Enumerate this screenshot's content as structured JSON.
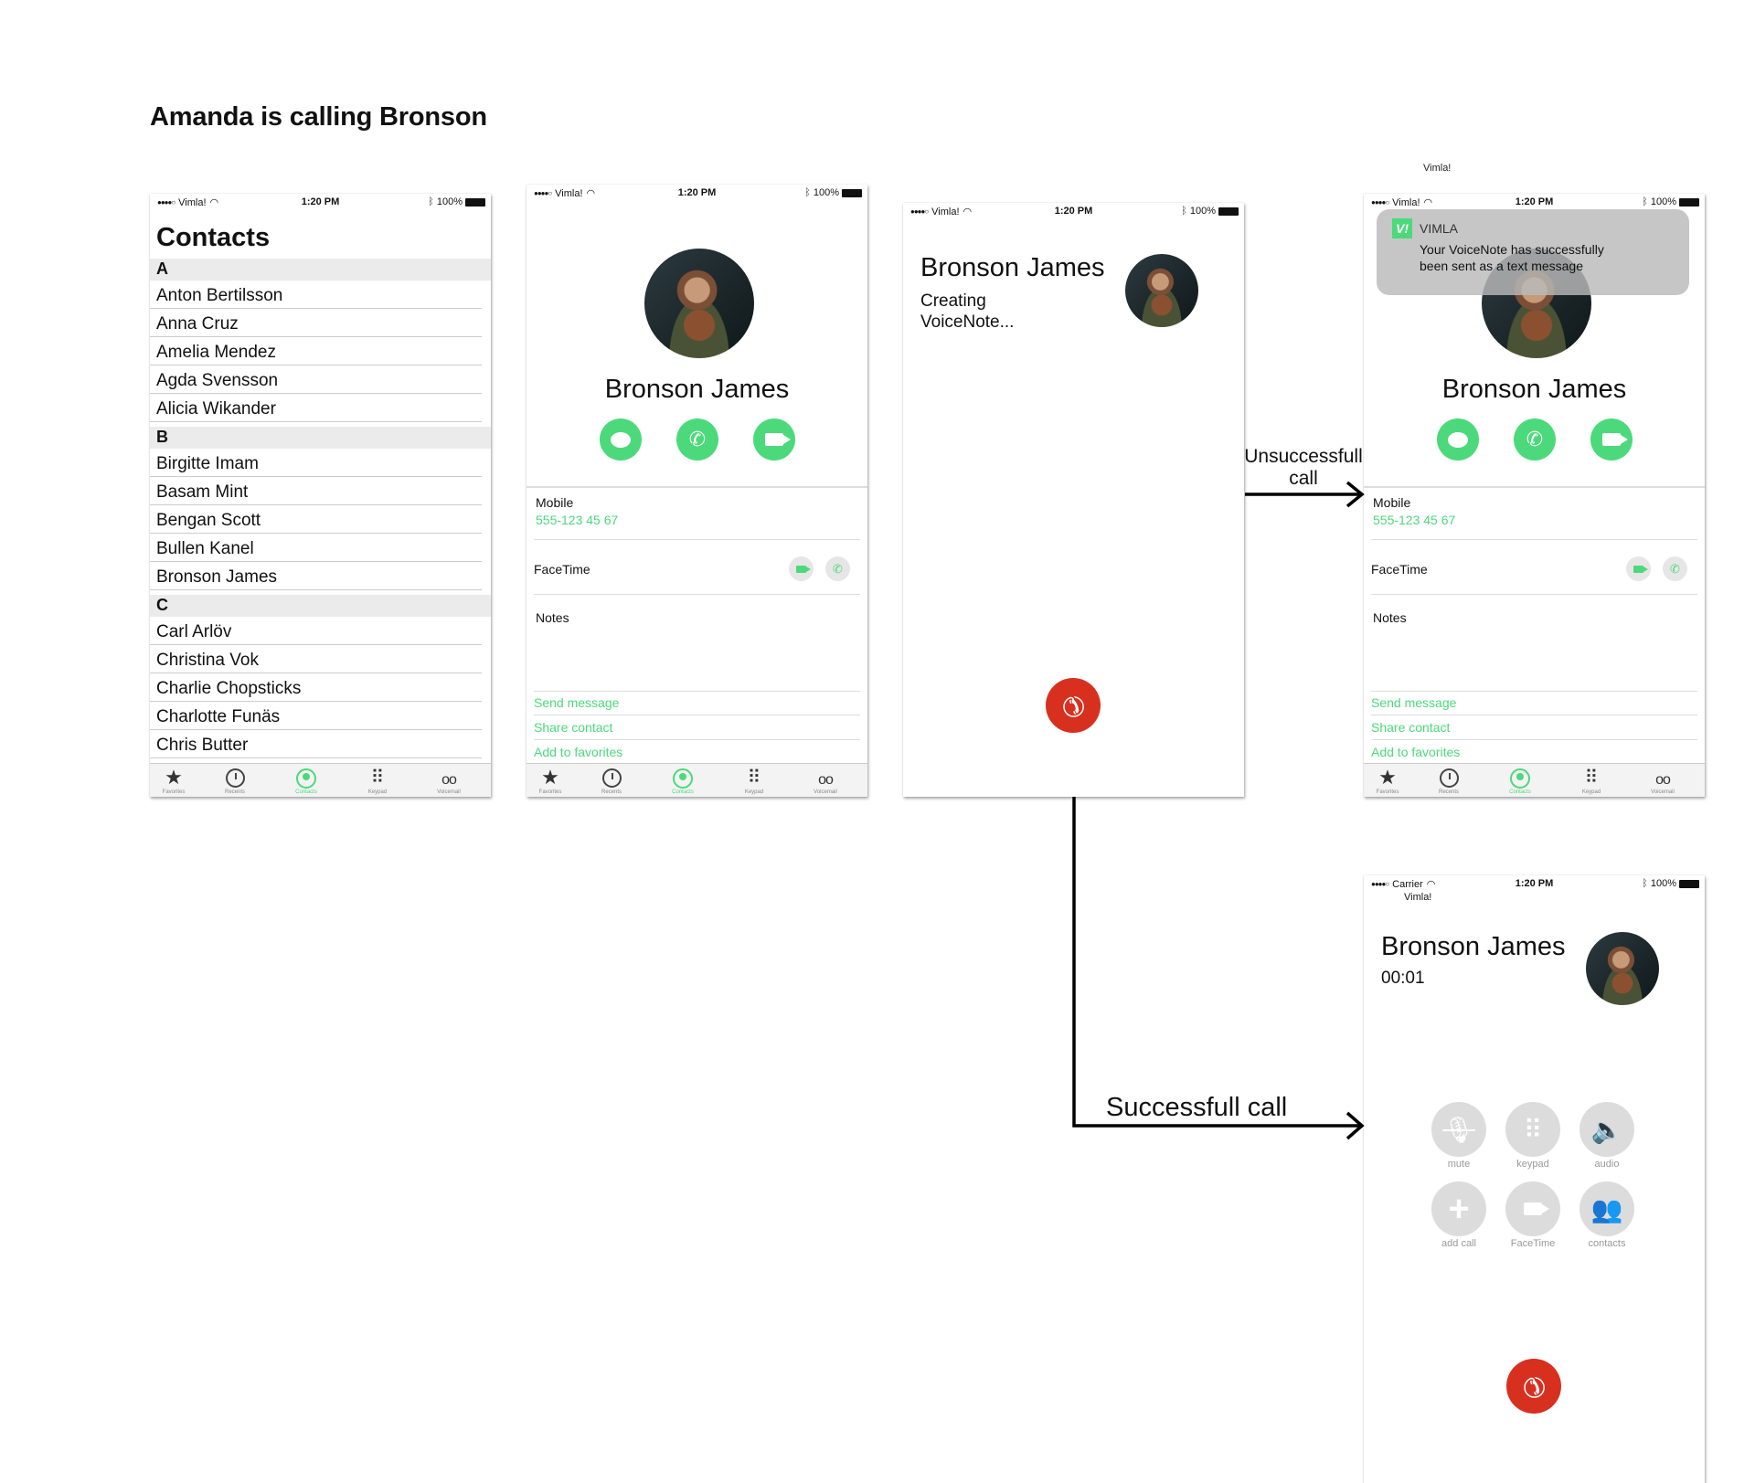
{
  "title": "Amanda is calling Bronson",
  "status": {
    "carrier": "Vimla!",
    "carrier2": "Carrier",
    "time": "1:20 PM",
    "battery": "100%",
    "dots": "●●●●○"
  },
  "top_caption": "Vimla!",
  "contacts": {
    "title": "Contacts",
    "sections": [
      {
        "letter": "A",
        "names": [
          "Anton Bertilsson",
          "Anna Cruz",
          "Amelia Mendez",
          "Agda Svensson",
          "Alicia Wikander"
        ]
      },
      {
        "letter": "B",
        "names": [
          "Birgitte Imam",
          "Basam Mint",
          "Bengan Scott",
          "Bullen Kanel",
          "Bronson James"
        ]
      },
      {
        "letter": "C",
        "names": [
          "Carl Arlöv",
          "Christina Vok",
          "Charlie Chopsticks",
          "Charlotte Funäs",
          "Chris Butter"
        ]
      }
    ]
  },
  "tabs": [
    "Favorites",
    "Recents",
    "Contacts",
    "Keypad",
    "Voicemail"
  ],
  "detail": {
    "name": "Bronson James",
    "mobile_label": "Mobile",
    "mobile_value": "555-123 45 67",
    "facetime_label": "FaceTime",
    "notes_label": "Notes",
    "links": [
      "Send message",
      "Share contact",
      "Add to favorites"
    ]
  },
  "creating": {
    "name": "Bronson James",
    "line1": "Creating",
    "line2": "VoiceNote..."
  },
  "notification": {
    "app": "VIMLA",
    "logo": "V!",
    "line1": "Your VoiceNote has successfully",
    "line2": "been sent as a text message"
  },
  "incall": {
    "name": "Bronson James",
    "timer": "00:01",
    "buttons": [
      "mute",
      "keypad",
      "audio",
      "add call",
      "FaceTime",
      "contacts"
    ]
  },
  "arrows": {
    "unsuccessful_1": "Unsuccessfull",
    "unsuccessful_2": "call",
    "successful": "Successfull call"
  },
  "colors": {
    "accent": "#4cd97b",
    "end_call": "#d8301f"
  }
}
